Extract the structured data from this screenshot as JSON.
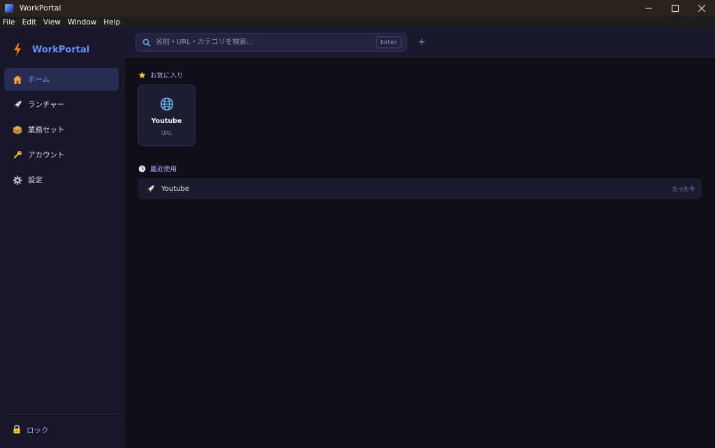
{
  "window": {
    "title": "WorkPortal",
    "controls": {
      "minimize": "—",
      "maximize": "☐",
      "close": "✕"
    }
  },
  "menubar": {
    "items": [
      "File",
      "Edit",
      "View",
      "Window",
      "Help"
    ]
  },
  "sidebar": {
    "brand": "WorkPortal",
    "items": [
      {
        "icon": "house-icon",
        "label": "ホーム",
        "active": true
      },
      {
        "icon": "rocket-icon",
        "label": "ランチャー",
        "active": false
      },
      {
        "icon": "package-icon",
        "label": "業務セット",
        "active": false
      },
      {
        "icon": "key-icon",
        "label": "アカウント",
        "active": false
      },
      {
        "icon": "gear-icon",
        "label": "設定",
        "active": false
      }
    ],
    "lock": {
      "icon": "lock-icon",
      "label": "ロック"
    }
  },
  "search": {
    "placeholder": "名前・URL・カテゴリを検索...",
    "value": "",
    "enter_hint": "Enter",
    "add_label": "+"
  },
  "favorites": {
    "title": "お気に入り",
    "icon": "star-icon",
    "items": [
      {
        "icon": "globe-icon",
        "name": "Youtube",
        "type": "URL"
      }
    ]
  },
  "recent": {
    "title": "最近使用",
    "icon": "clock-icon",
    "items": [
      {
        "icon": "rocket-icon",
        "name": "Youtube",
        "time": "たった今"
      }
    ]
  },
  "colors": {
    "accent": "#6b8cff",
    "active_nav_bg": "#2a2b52",
    "secondary_text": "#b9a6ff",
    "background": "#0f0f18",
    "sidebar_bg": "#171729"
  }
}
